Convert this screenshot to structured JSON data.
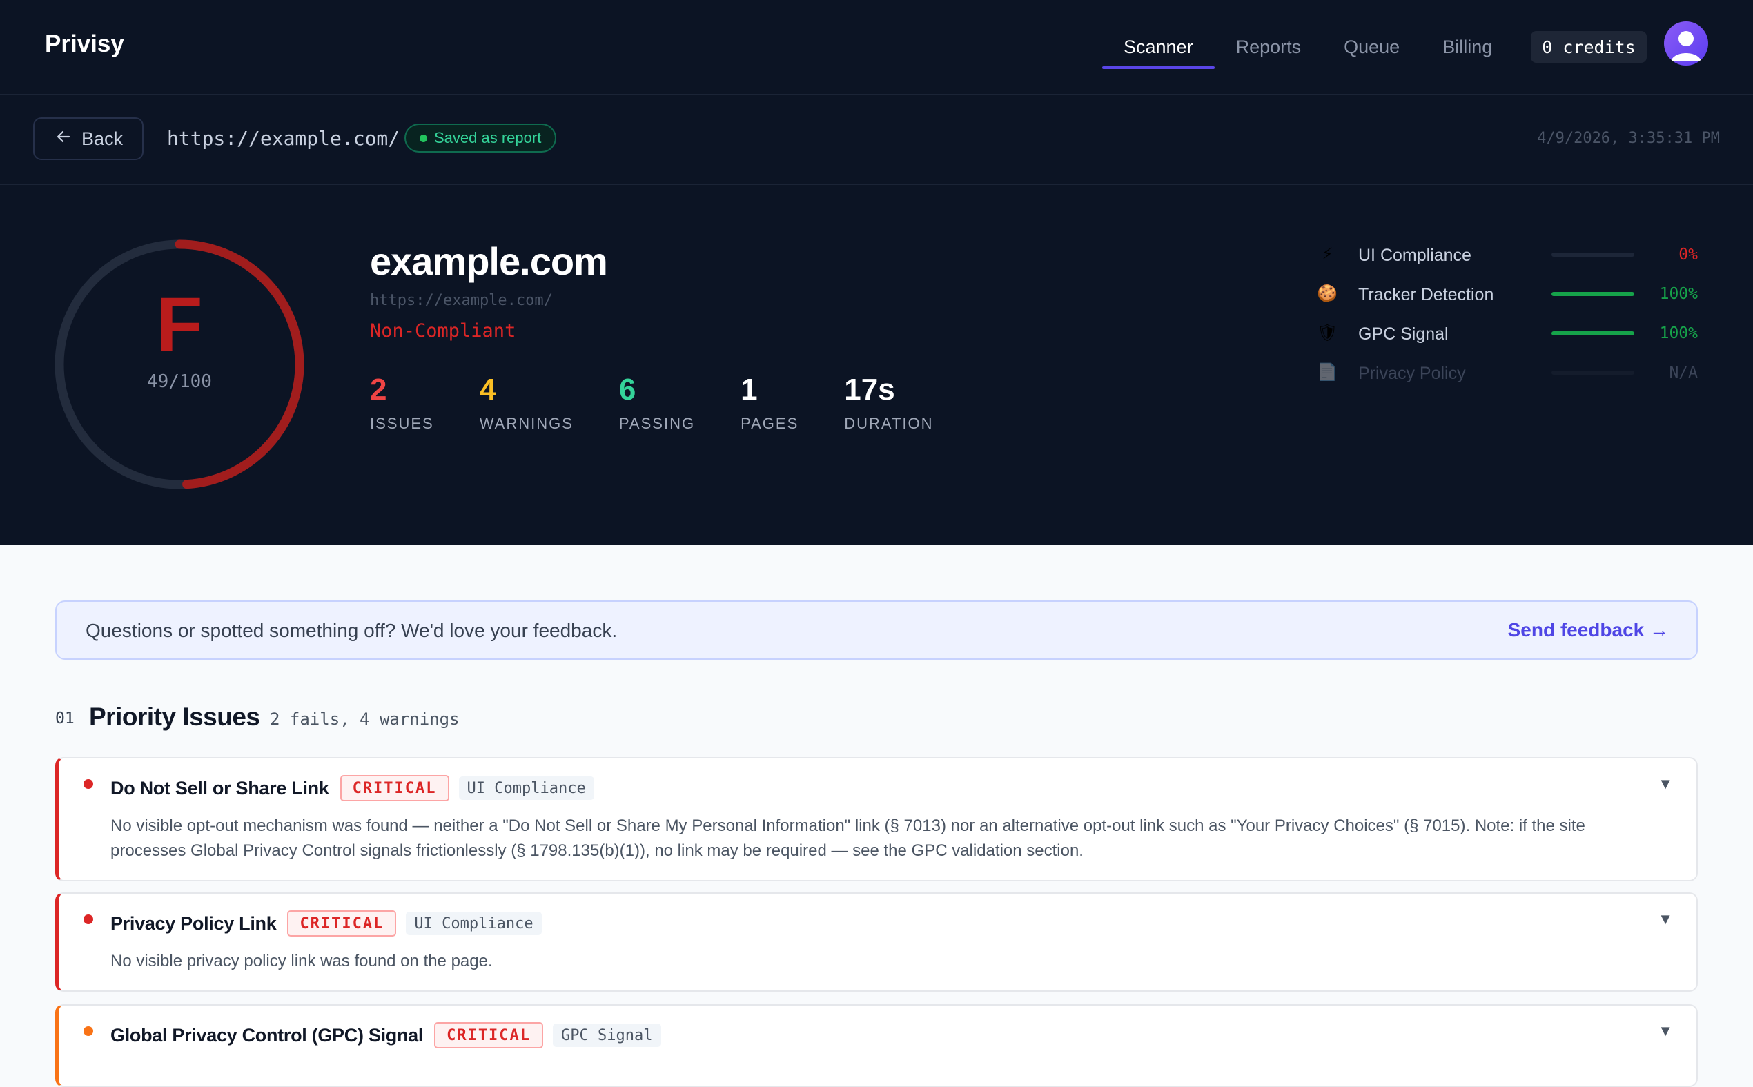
{
  "app": {
    "brand": "Privisy"
  },
  "nav": {
    "tabs": [
      {
        "label": "Scanner",
        "active": true
      },
      {
        "label": "Reports",
        "active": false
      },
      {
        "label": "Queue",
        "active": false
      },
      {
        "label": "Billing",
        "active": false
      }
    ],
    "credits": "0 credits",
    "avatar_icon": "user-avatar-icon"
  },
  "subbar": {
    "back_label": "Back",
    "url": "https://example.com/",
    "saved_label": "Saved as report",
    "timestamp": "4/9/2026, 3:35:31 PM"
  },
  "summary": {
    "grade": "F",
    "score_text": "49/100",
    "score_value": 49,
    "site": "example.com",
    "site_url": "https://example.com/",
    "status": "Non-Compliant",
    "stats": [
      {
        "value": "2",
        "label": "ISSUES",
        "color": "#ef4444"
      },
      {
        "value": "4",
        "label": "WARNINGS",
        "color": "#fbbf24"
      },
      {
        "value": "6",
        "label": "PASSING",
        "color": "#34d399"
      },
      {
        "value": "1",
        "label": "PAGES",
        "color": "#ffffff"
      },
      {
        "value": "17s",
        "label": "DURATION",
        "color": "#ffffff"
      }
    ],
    "checks": [
      {
        "icon": "lightning-icon",
        "glyph": "⚡",
        "name": "UI Compliance",
        "percent_text": "0%",
        "percent": 0,
        "color": "#dc2626",
        "dim": false
      },
      {
        "icon": "cookie-icon",
        "glyph": "🍪",
        "name": "Tracker Detection",
        "percent_text": "100%",
        "percent": 100,
        "color": "#16a34a",
        "dim": false
      },
      {
        "icon": "shield-icon",
        "glyph": "🛡",
        "name": "GPC Signal",
        "percent_text": "100%",
        "percent": 100,
        "color": "#16a34a",
        "dim": false
      },
      {
        "icon": "document-icon",
        "glyph": "📄",
        "name": "Privacy Policy",
        "percent_text": "N/A",
        "percent": 0,
        "color": "#3b4458",
        "dim": true
      }
    ]
  },
  "feedback": {
    "text": "Questions or spotted something off? We'd love your feedback.",
    "link": "Send feedback →"
  },
  "section": {
    "number": "01",
    "title": "Priority Issues",
    "subtitle": "2 fails, 4 warnings"
  },
  "issues": [
    {
      "title": "Do Not Sell or Share Link",
      "severity": "CRITICAL",
      "category": "UI Compliance",
      "dot_color": "#dc2626",
      "border_color": "#dc2626",
      "description": "No visible opt-out mechanism was found — neither a \"Do Not Sell or Share My Personal Information\" link (§ 7013) nor an alternative opt-out link such as \"Your Privacy Choices\" (§ 7015). Note: if the site processes Global Privacy Control signals frictionlessly (§ 1798.135(b)(1)), no link may be required — see the GPC validation section."
    },
    {
      "title": "Privacy Policy Link",
      "severity": "CRITICAL",
      "category": "UI Compliance",
      "dot_color": "#dc2626",
      "border_color": "#dc2626",
      "description": "No visible privacy policy link was found on the page."
    },
    {
      "title": "Global Privacy Control (GPC) Signal",
      "severity": "CRITICAL",
      "category": "GPC Signal",
      "dot_color": "#f97316",
      "border_color": "#f97316",
      "description": ""
    }
  ]
}
